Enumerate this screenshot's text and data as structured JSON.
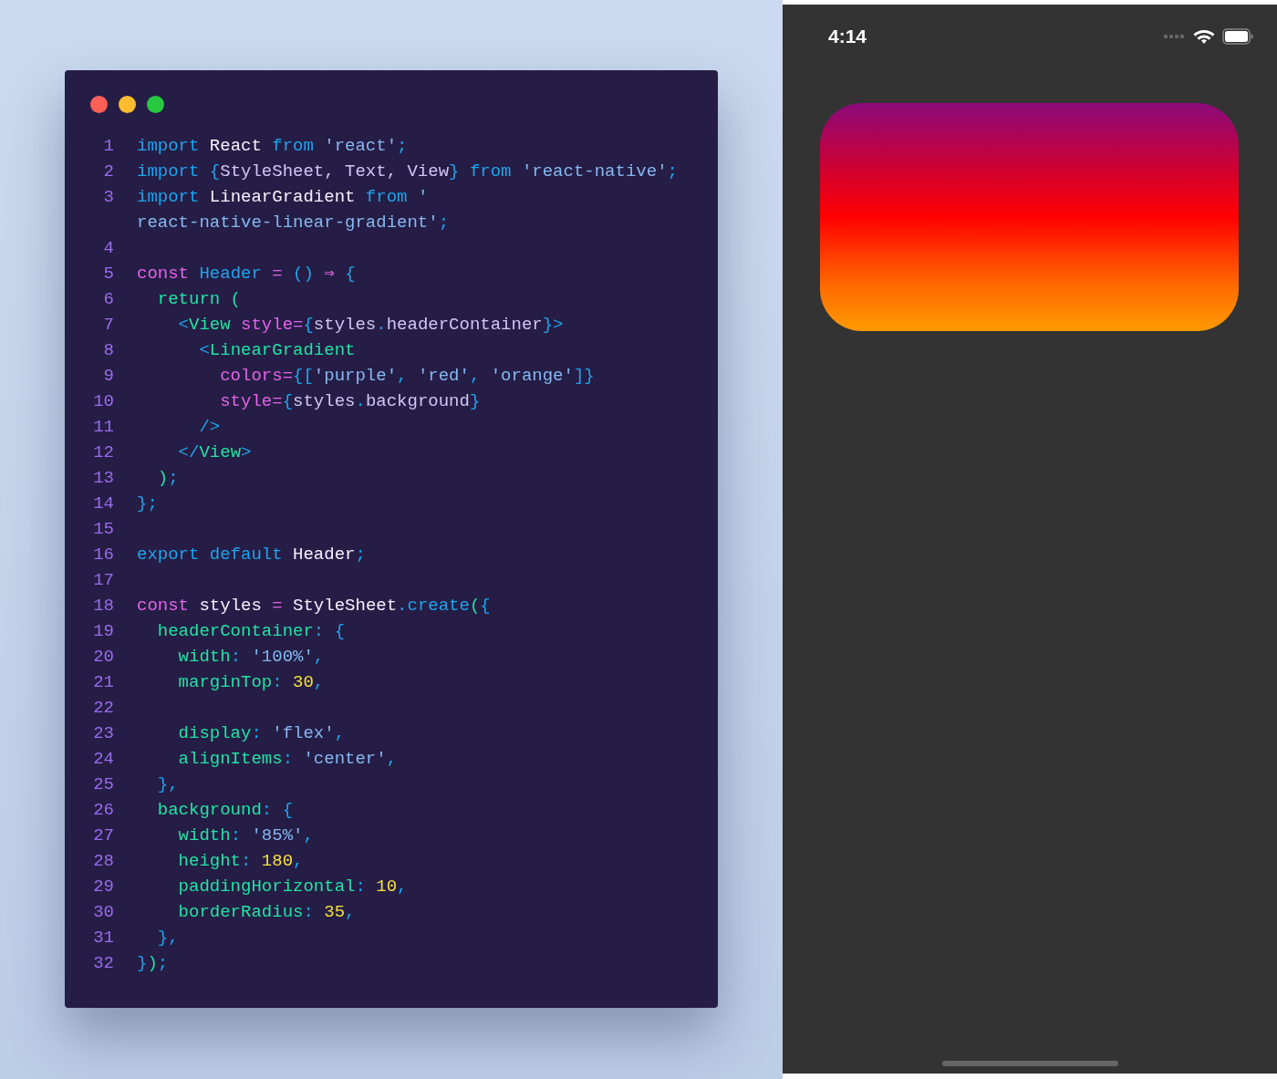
{
  "editor": {
    "lines": [
      {
        "number": "1",
        "tokens": [
          {
            "text": "import ",
            "kind": "kw"
          },
          {
            "text": "React ",
            "kind": "id"
          },
          {
            "text": "from ",
            "kind": "kw"
          },
          {
            "text": "'react'",
            "kind": "str"
          },
          {
            "text": ";",
            "kind": "pu"
          }
        ]
      },
      {
        "number": "2",
        "tokens": [
          {
            "text": "import ",
            "kind": "kw"
          },
          {
            "text": "{",
            "kind": "pu"
          },
          {
            "text": "StyleSheet, Text, View",
            "kind": "lv"
          },
          {
            "text": "}",
            "kind": "pu"
          },
          {
            "text": " from ",
            "kind": "kw"
          },
          {
            "text": "'react-native'",
            "kind": "str"
          },
          {
            "text": ";",
            "kind": "pu"
          }
        ]
      },
      {
        "number": "3",
        "tokens": [
          {
            "text": "import ",
            "kind": "kw"
          },
          {
            "text": "LinearGradient ",
            "kind": "id"
          },
          {
            "text": "from ",
            "kind": "kw"
          },
          {
            "text": "'",
            "kind": "str"
          }
        ]
      },
      {
        "tokens": [
          {
            "text": "react-native-linear-gradient'",
            "kind": "str"
          },
          {
            "text": ";",
            "kind": "pu"
          }
        ]
      },
      {
        "number": "4"
      },
      {
        "number": "5",
        "tokens": [
          {
            "text": "const ",
            "kind": "pk"
          },
          {
            "text": "Header ",
            "kind": "kw"
          },
          {
            "text": "= ",
            "kind": "pk"
          },
          {
            "text": "() ",
            "kind": "pu"
          },
          {
            "text": "⇒ ",
            "kind": "pk"
          },
          {
            "text": "{",
            "kind": "pu"
          }
        ]
      },
      {
        "number": "6",
        "tokens": [
          {
            "text": "  return (",
            "kind": "gr"
          }
        ]
      },
      {
        "number": "7",
        "tokens": [
          {
            "text": "    <",
            "kind": "pu"
          },
          {
            "text": "View ",
            "kind": "gr"
          },
          {
            "text": "style=",
            "kind": "pk"
          },
          {
            "text": "{",
            "kind": "pu"
          },
          {
            "text": "styles",
            "kind": "lv"
          },
          {
            "text": ".",
            "kind": "pu"
          },
          {
            "text": "headerContainer",
            "kind": "lv"
          },
          {
            "text": "}>",
            "kind": "pu"
          }
        ]
      },
      {
        "number": "8",
        "tokens": [
          {
            "text": "      <",
            "kind": "pu"
          },
          {
            "text": "LinearGradient",
            "kind": "gr"
          }
        ]
      },
      {
        "number": "9",
        "tokens": [
          {
            "text": "        colors=",
            "kind": "pk"
          },
          {
            "text": "{[",
            "kind": "pu"
          },
          {
            "text": "'purple'",
            "kind": "str"
          },
          {
            "text": ", ",
            "kind": "pu"
          },
          {
            "text": "'red'",
            "kind": "str"
          },
          {
            "text": ", ",
            "kind": "pu"
          },
          {
            "text": "'orange'",
            "kind": "str"
          },
          {
            "text": "]}",
            "kind": "pu"
          }
        ]
      },
      {
        "number": "10",
        "tokens": [
          {
            "text": "        style=",
            "kind": "pk"
          },
          {
            "text": "{",
            "kind": "pu"
          },
          {
            "text": "styles",
            "kind": "lv"
          },
          {
            "text": ".",
            "kind": "pu"
          },
          {
            "text": "background",
            "kind": "lv"
          },
          {
            "text": "}",
            "kind": "pu"
          }
        ]
      },
      {
        "number": "11",
        "tokens": [
          {
            "text": "      />",
            "kind": "pu"
          }
        ]
      },
      {
        "number": "12",
        "tokens": [
          {
            "text": "    </",
            "kind": "pu"
          },
          {
            "text": "View",
            "kind": "gr"
          },
          {
            "text": ">",
            "kind": "pu"
          }
        ]
      },
      {
        "number": "13",
        "tokens": [
          {
            "text": "  )",
            "kind": "gr"
          },
          {
            "text": ";",
            "kind": "pu"
          }
        ]
      },
      {
        "number": "14",
        "tokens": [
          {
            "text": "};",
            "kind": "pu"
          }
        ]
      },
      {
        "number": "15"
      },
      {
        "number": "16",
        "tokens": [
          {
            "text": "export default ",
            "kind": "kw"
          },
          {
            "text": "Header",
            "kind": "id"
          },
          {
            "text": ";",
            "kind": "pu"
          }
        ]
      },
      {
        "number": "17"
      },
      {
        "number": "18",
        "tokens": [
          {
            "text": "const ",
            "kind": "pk"
          },
          {
            "text": "styles ",
            "kind": "id"
          },
          {
            "text": "= ",
            "kind": "pk"
          },
          {
            "text": "StyleSheet",
            "kind": "id"
          },
          {
            "text": ".create",
            "kind": "kw"
          },
          {
            "text": "(",
            "kind": "gr"
          },
          {
            "text": "{",
            "kind": "pu"
          }
        ]
      },
      {
        "number": "19",
        "tokens": [
          {
            "text": "  headerContainer",
            "kind": "gr"
          },
          {
            "text": ": {",
            "kind": "pu"
          }
        ]
      },
      {
        "number": "20",
        "tokens": [
          {
            "text": "    width",
            "kind": "gr"
          },
          {
            "text": ": ",
            "kind": "pu"
          },
          {
            "text": "'100%'",
            "kind": "str"
          },
          {
            "text": ",",
            "kind": "pu"
          }
        ]
      },
      {
        "number": "21",
        "tokens": [
          {
            "text": "    marginTop",
            "kind": "gr"
          },
          {
            "text": ": ",
            "kind": "pu"
          },
          {
            "text": "30",
            "kind": "num"
          },
          {
            "text": ",",
            "kind": "pu"
          }
        ]
      },
      {
        "number": "22"
      },
      {
        "number": "23",
        "tokens": [
          {
            "text": "    display",
            "kind": "gr"
          },
          {
            "text": ": ",
            "kind": "pu"
          },
          {
            "text": "'flex'",
            "kind": "str"
          },
          {
            "text": ",",
            "kind": "pu"
          }
        ]
      },
      {
        "number": "24",
        "tokens": [
          {
            "text": "    alignItems",
            "kind": "gr"
          },
          {
            "text": ": ",
            "kind": "pu"
          },
          {
            "text": "'center'",
            "kind": "str"
          },
          {
            "text": ",",
            "kind": "pu"
          }
        ]
      },
      {
        "number": "25",
        "tokens": [
          {
            "text": "  },",
            "kind": "pu"
          }
        ]
      },
      {
        "number": "26",
        "tokens": [
          {
            "text": "  background",
            "kind": "gr"
          },
          {
            "text": ": {",
            "kind": "pu"
          }
        ]
      },
      {
        "number": "27",
        "tokens": [
          {
            "text": "    width",
            "kind": "gr"
          },
          {
            "text": ": ",
            "kind": "pu"
          },
          {
            "text": "'85%'",
            "kind": "str"
          },
          {
            "text": ",",
            "kind": "pu"
          }
        ]
      },
      {
        "number": "28",
        "tokens": [
          {
            "text": "    height",
            "kind": "gr"
          },
          {
            "text": ": ",
            "kind": "pu"
          },
          {
            "text": "180",
            "kind": "num"
          },
          {
            "text": ",",
            "kind": "pu"
          }
        ]
      },
      {
        "number": "29",
        "tokens": [
          {
            "text": "    paddingHorizontal",
            "kind": "gr"
          },
          {
            "text": ": ",
            "kind": "pu"
          },
          {
            "text": "10",
            "kind": "num"
          },
          {
            "text": ",",
            "kind": "pu"
          }
        ]
      },
      {
        "number": "30",
        "tokens": [
          {
            "text": "    borderRadius",
            "kind": "gr"
          },
          {
            "text": ": ",
            "kind": "pu"
          },
          {
            "text": "35",
            "kind": "num"
          },
          {
            "text": ",",
            "kind": "pu"
          }
        ]
      },
      {
        "number": "31",
        "tokens": [
          {
            "text": "  },",
            "kind": "pu"
          }
        ]
      },
      {
        "number": "32",
        "tokens": [
          {
            "text": "}",
            "kind": "pu"
          },
          {
            "text": ")",
            "kind": "gr"
          },
          {
            "text": ";",
            "kind": "pu"
          }
        ]
      }
    ]
  },
  "phone": {
    "status_bar": {
      "time": "4:14"
    }
  }
}
